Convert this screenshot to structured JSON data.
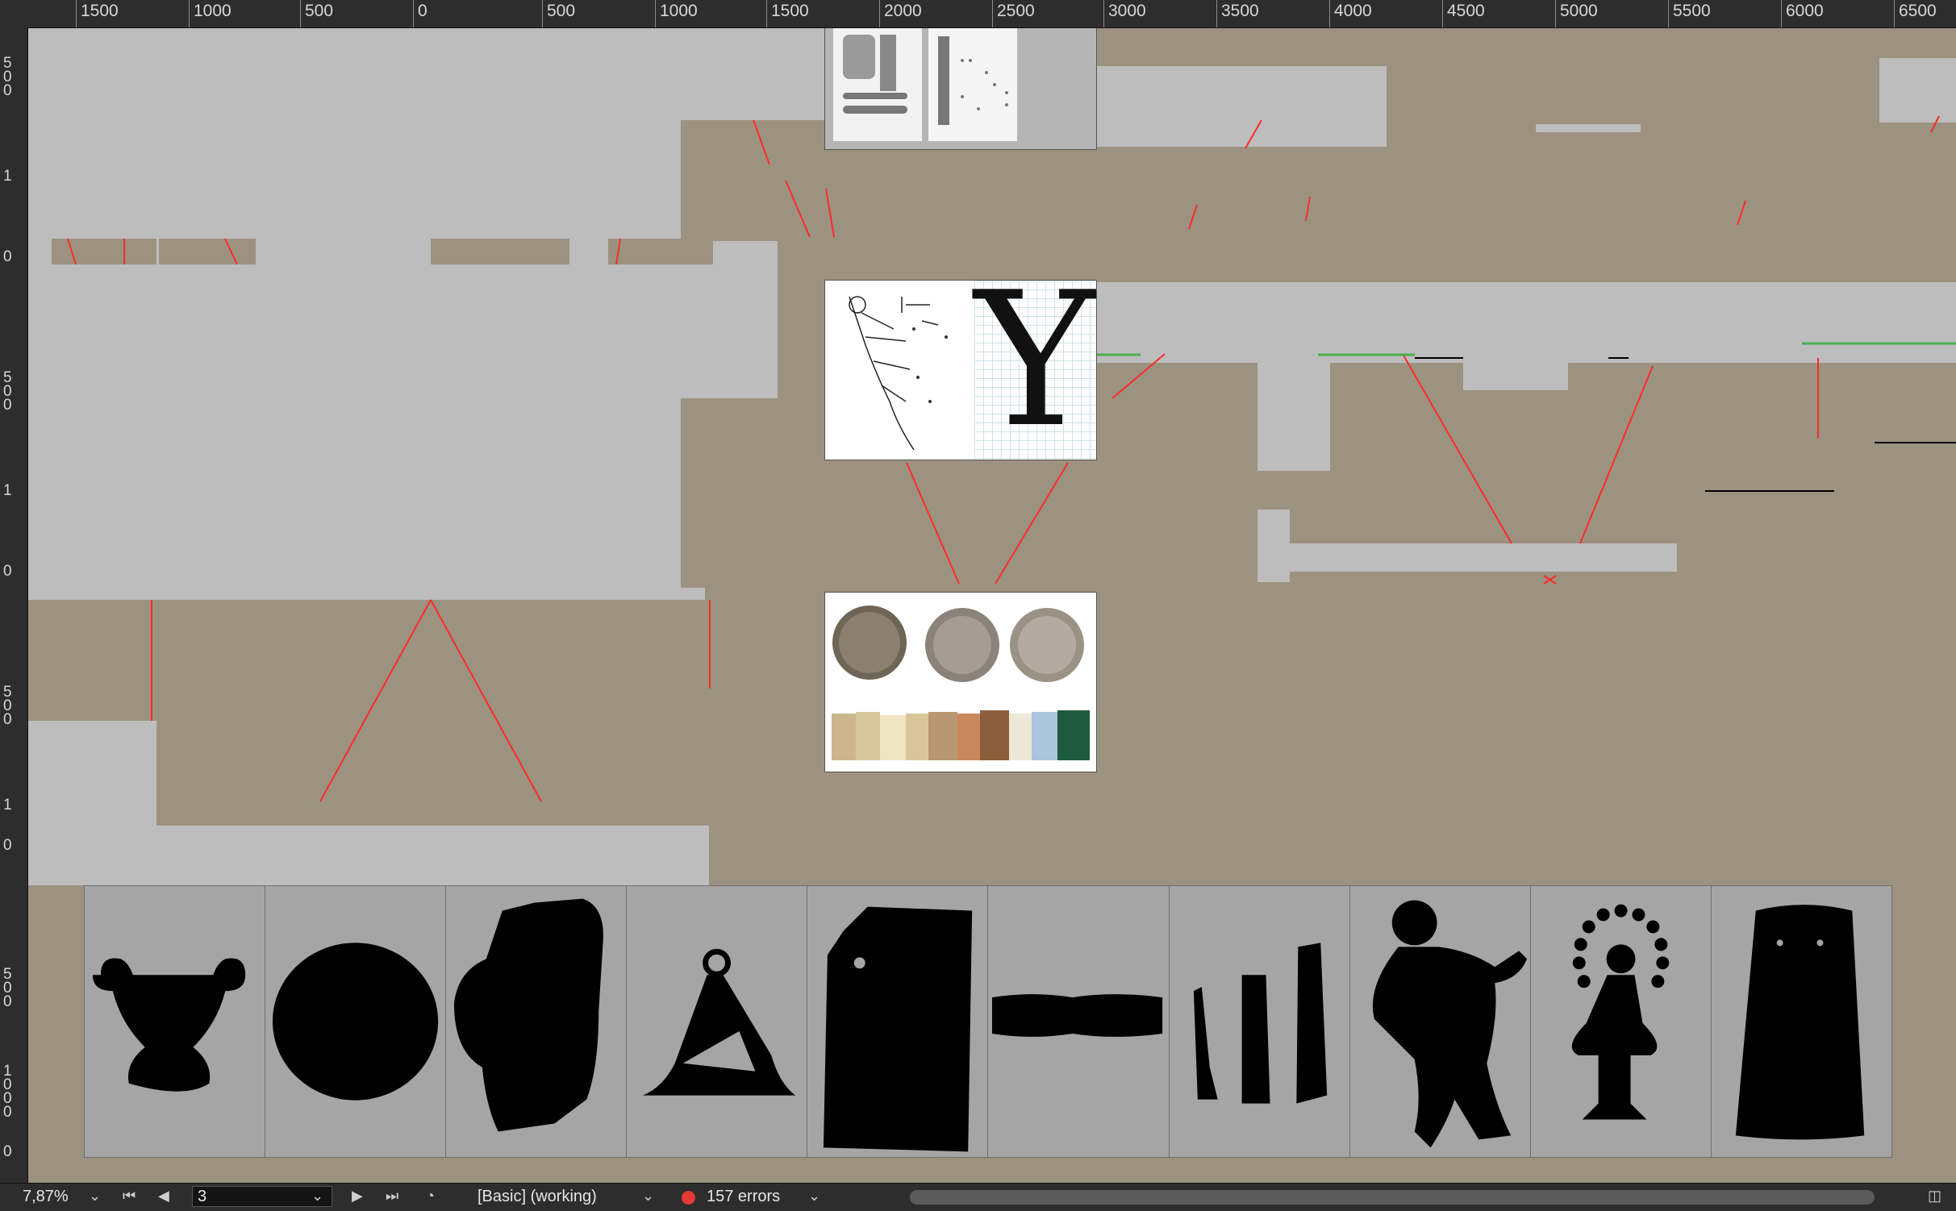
{
  "ruler": {
    "h_labels": [
      "1500",
      "1000",
      "500",
      "0",
      "500",
      "1000",
      "1500",
      "2000",
      "2500",
      "3000",
      "3500",
      "4000",
      "4500",
      "5000",
      "5500",
      "6000",
      "6500"
    ],
    "v_labels": [
      "5\n0\n0",
      "1",
      "0",
      "5\n0\n0",
      "1",
      "0",
      "5\n0\n0",
      "1",
      "0",
      "5\n0\n0",
      "1\n0\n0\n0",
      "0"
    ]
  },
  "status": {
    "zoom": "7,87%",
    "page": "3",
    "preflight_profile": "[Basic] (working)",
    "errors": "157 errors"
  },
  "frames": [
    {
      "name": "frame-scan-pages"
    },
    {
      "name": "frame-drawing-and-letter",
      "letter": "Y"
    },
    {
      "name": "frame-coins-and-books"
    }
  ],
  "shapes": [
    "vase-silhouette",
    "disc-silhouette",
    "fragment-silhouette",
    "bell-silhouette",
    "slab-silhouette",
    "bar-silhouette",
    "tools-silhouette",
    "figure-silhouette",
    "idol-silhouette",
    "trapezoid-silhouette"
  ],
  "colors": {
    "pasteboard": "#9c9280",
    "page": "#bdbdbd",
    "guides": "#ff2a2a",
    "chrome": "#2d2d2d",
    "error": "#e53935"
  }
}
